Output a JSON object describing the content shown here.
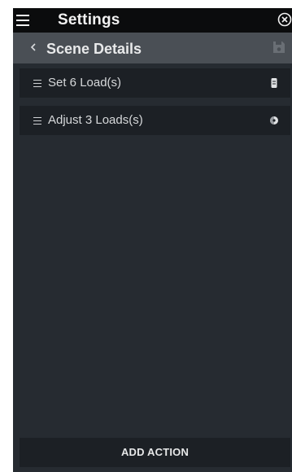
{
  "header": {
    "title": "Settings",
    "menu_icon": "hamburger-menu-icon",
    "close_icon": "close-circle-icon"
  },
  "subheader": {
    "title": "Scene Details",
    "back_icon": "chevron-left-icon",
    "save_icon": "save-disk-icon"
  },
  "actions": [
    {
      "label": "Set 6 Load(s)",
      "icon": "load-device-icon"
    },
    {
      "label": "Adjust 3 Loads(s)",
      "icon": "adjust-load-icon"
    }
  ],
  "footer": {
    "add_action_label": "ADD ACTION"
  },
  "colors": {
    "header_bg": "#0b0c0d",
    "subheader_bg": "#4a4f55",
    "panel_bg": "#262b31",
    "row_bg": "#1c2025",
    "text": "#d6d8da"
  }
}
